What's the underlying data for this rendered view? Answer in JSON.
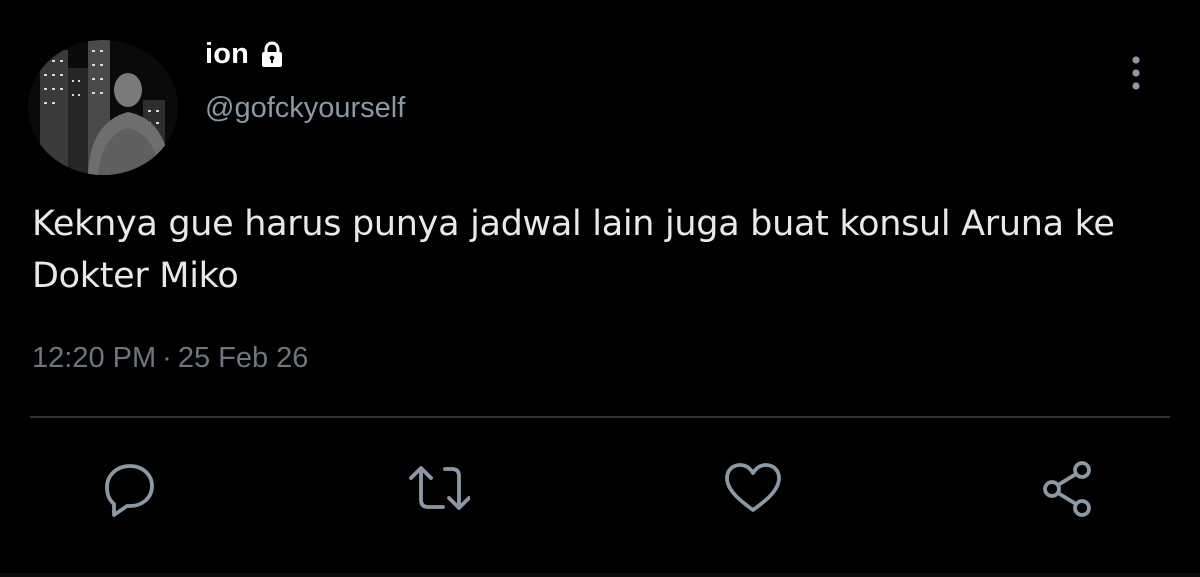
{
  "tweet": {
    "display_name": "ion",
    "handle": "@gofckyourself",
    "text": "Keknya gue harus punya jadwal lain juga buat konsul Aruna ke Dokter Miko",
    "time": "12:20 PM",
    "separator": "·",
    "date": "25 Feb 26",
    "protected": true
  },
  "icons": {
    "lock": "lock-icon",
    "more": "more-vertical-icon",
    "reply": "reply-icon",
    "retweet": "retweet-icon",
    "like": "heart-icon",
    "share": "share-icon"
  },
  "colors": {
    "background": "#000000",
    "text_primary": "#e7e9ea",
    "text_secondary": "#8b98a5",
    "meta": "#6e767d",
    "icon": "#8b98a5",
    "divider": "#2f3336"
  }
}
